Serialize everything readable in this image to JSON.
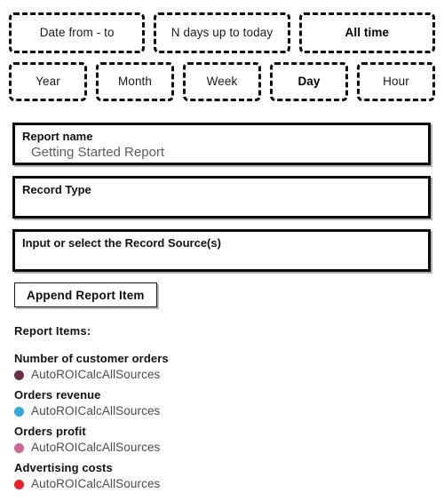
{
  "period_selector": {
    "options": [
      {
        "label": "Date from - to",
        "selected": false
      },
      {
        "label": "N days up to today",
        "selected": false
      },
      {
        "label": "All time",
        "selected": true
      }
    ]
  },
  "granularity_selector": {
    "options": [
      {
        "label": "Year",
        "selected": false
      },
      {
        "label": "Month",
        "selected": false
      },
      {
        "label": "Week",
        "selected": false
      },
      {
        "label": "Day",
        "selected": true
      },
      {
        "label": "Hour",
        "selected": false
      }
    ]
  },
  "form": {
    "report_name": {
      "label": "Report name",
      "value": "Getting Started Report"
    },
    "record_type": {
      "label": "Record Type",
      "value": ""
    },
    "record_source": {
      "label": "Input or select the Record Source(s)",
      "value": ""
    }
  },
  "actions": {
    "append_report_item": "Append Report Item"
  },
  "report_items": {
    "heading": "Report Items:",
    "items": [
      {
        "title": "Number of customer orders",
        "source": "AutoROICalcAllSources",
        "color": "#6B2D4A"
      },
      {
        "title": "Orders revenue",
        "source": "AutoROICalcAllSources",
        "color": "#35A9DB"
      },
      {
        "title": "Orders profit",
        "source": "AutoROICalcAllSources",
        "color": "#CC6699"
      },
      {
        "title": "Advertising costs",
        "source": "AutoROICalcAllSources",
        "color": "#E8242B"
      }
    ]
  }
}
